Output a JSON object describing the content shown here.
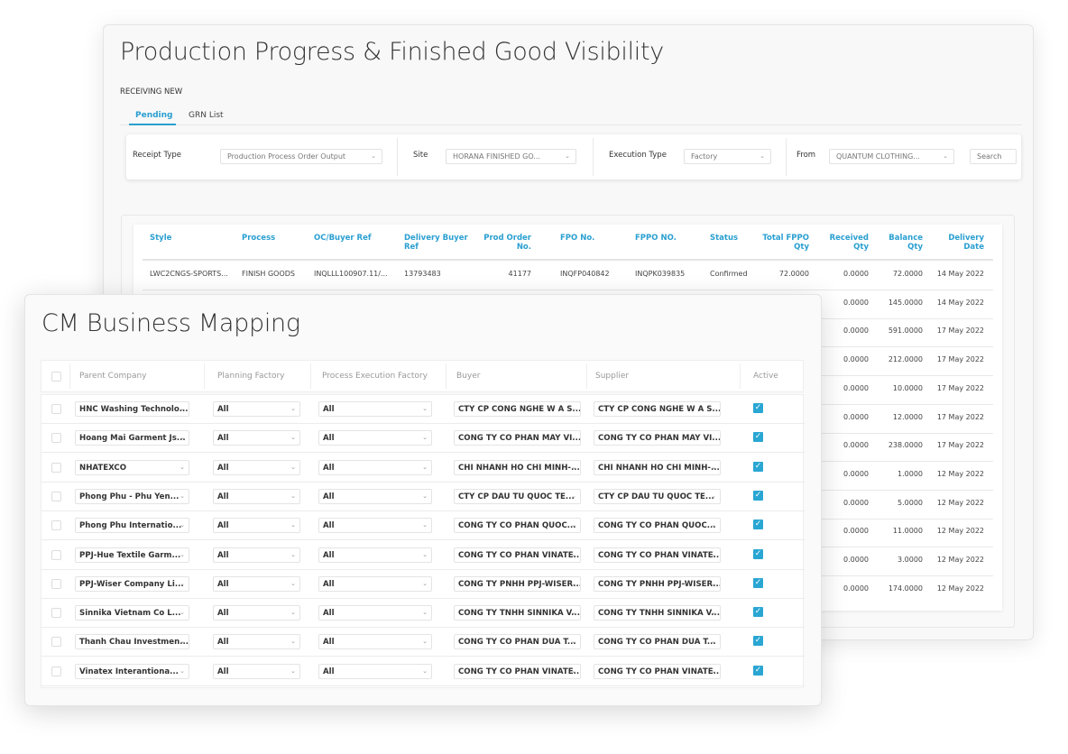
{
  "back": {
    "title": "Production Progress & Finished Good Visibility",
    "section": "RECEIVING NEW",
    "tabs": [
      {
        "label": "Pending",
        "active": true
      },
      {
        "label": "GRN List",
        "active": false
      }
    ],
    "filters": {
      "receipt_type_label": "Receipt Type",
      "receipt_type_value": "Production Process Order Output",
      "site_label": "Site",
      "site_value": "HORANA FINISHED GO...",
      "execution_type_label": "Execution Type",
      "execution_type_value": "Factory",
      "from_label": "From",
      "from_value": "QUANTUM CLOTHING...",
      "search_placeholder": "Search"
    },
    "columns": [
      "Style",
      "Process",
      "OC/Buyer Ref",
      "Delivery Buyer Ref",
      "Prod Order No.",
      "FPO No.",
      "FPPO NO.",
      "Status",
      "Total FPPO Qty",
      "Received Qty",
      "Balance Qty",
      "Delivery Date"
    ],
    "first_row": [
      "LWC2CNGS-SPORTS...",
      "FINISH GOODS",
      "INQLLL100907.11/...",
      "13793483",
      "41177",
      "INQFP040842",
      "INQPK039835",
      "Confirmed",
      "72.0000",
      "0.0000",
      "72.0000",
      "14 May 2022"
    ],
    "partial_rows": [
      [
        "0.0000",
        "145.0000",
        "14 May 2022"
      ],
      [
        "0.0000",
        "591.0000",
        "17 May 2022"
      ],
      [
        "0.0000",
        "212.0000",
        "17 May 2022"
      ],
      [
        "0.0000",
        "10.0000",
        "17 May 2022"
      ],
      [
        "0.0000",
        "12.0000",
        "17 May 2022"
      ],
      [
        "0.0000",
        "238.0000",
        "17 May 2022"
      ],
      [
        "0.0000",
        "1.0000",
        "12 May 2022"
      ],
      [
        "0.0000",
        "5.0000",
        "12 May 2022"
      ],
      [
        "0.0000",
        "11.0000",
        "12 May 2022"
      ],
      [
        "0.0000",
        "3.0000",
        "12 May 2022"
      ],
      [
        "0.0000",
        "174.0000",
        "12 May 2022"
      ]
    ]
  },
  "front": {
    "title": "CM Business Mapping",
    "columns": [
      "Parent Company",
      "Planning Factory",
      "Process Execution Factory",
      "Buyer",
      "Supplier",
      "Active"
    ],
    "rows": [
      {
        "parent": "HNC Washing Technolo...",
        "planning": "All",
        "execution": "All",
        "buyer": "CTY CP CONG NGHE W A S...",
        "supplier": "CTY CP CONG NGHE W A S...",
        "active": true
      },
      {
        "parent": "Hoang Mai Garment Js...",
        "planning": "All",
        "execution": "All",
        "buyer": "CONG TY CO PHAN MAY VI...",
        "supplier": "CONG TY CO PHAN MAY VI...",
        "active": true
      },
      {
        "parent": "NHATEXCO",
        "planning": "All",
        "execution": "All",
        "buyer": "CHI NHANH HO CHI MINH-...",
        "supplier": "CHI NHANH HO CHI MINH-...",
        "active": true
      },
      {
        "parent": "Phong Phu - Phu Yen...",
        "planning": "All",
        "execution": "All",
        "buyer": "CTY CP DAU TU QUOC TE...",
        "supplier": "CTY CP DAU TU QUOC TE...",
        "active": true
      },
      {
        "parent": "Phong Phu Internatio...",
        "planning": "All",
        "execution": "All",
        "buyer": "CONG TY CO PHAN QUOC...",
        "supplier": "CONG TY CO PHAN QUOC...",
        "active": true
      },
      {
        "parent": "PPJ-Hue Textile Garm...",
        "planning": "All",
        "execution": "All",
        "buyer": "CONG TY CO PHAN VINATE...",
        "supplier": "CONG TY CO PHAN VINATE...",
        "active": true
      },
      {
        "parent": "PPJ-Wiser Company Li...",
        "planning": "All",
        "execution": "All",
        "buyer": "CONG TY PNHH PPJ-WISER...",
        "supplier": "CONG TY PNHH PPJ-WISER...",
        "active": true
      },
      {
        "parent": "Sinnika Vietnam Co L...",
        "planning": "All",
        "execution": "All",
        "buyer": "CONG TY TNHH SINNIKA V...",
        "supplier": "CONG TY TNHH SINNIKA V...",
        "active": true
      },
      {
        "parent": "Thanh Chau Investmen...",
        "planning": "All",
        "execution": "All",
        "buyer": "CONG TY CO PHAN DUA T...",
        "supplier": "CONG TY CO PHAN DUA T...",
        "active": true
      },
      {
        "parent": "Vinatex Interantiona...",
        "planning": "All",
        "execution": "All",
        "buyer": "CONG TY CO PHAN VINATE...",
        "supplier": "CONG TY CO PHAN VINATE...",
        "active": true
      }
    ]
  },
  "colors": {
    "accent": "#2a9fd0",
    "checkbox": "#2aa6d3"
  }
}
